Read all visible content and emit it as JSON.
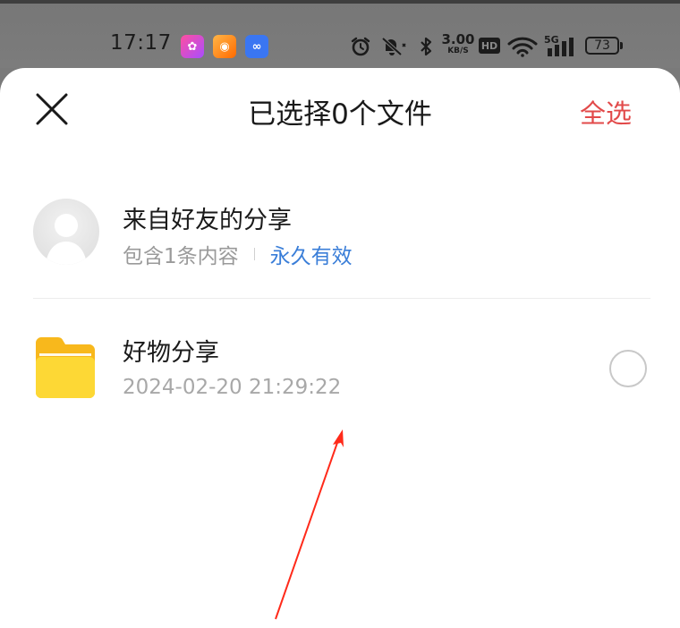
{
  "status_bar": {
    "time": "17:17",
    "app1_glyph": "✿",
    "app2_glyph": "◉",
    "app3_glyph": "∞",
    "net_speed_value": "3.00",
    "net_speed_unit": "KB/S",
    "hd_label": "HD",
    "network_label": "5G",
    "battery_level": "73",
    "icons": [
      "alarm-icon",
      "mute-icon",
      "bluetooth-icon",
      "wifi-icon",
      "signal-icon",
      "battery-icon"
    ]
  },
  "header": {
    "title": "已选择0个文件",
    "select_all_label": "全选",
    "close_icon": "close-icon"
  },
  "share": {
    "title": "来自好友的分享",
    "content_count": "包含1条内容",
    "validity": "永久有效",
    "avatar_icon": "person-icon"
  },
  "files": [
    {
      "name": "好物分享",
      "date": "2024-02-20 21:29:22",
      "icon": "folder-icon",
      "selected": false
    }
  ],
  "colors": {
    "accent_red": "#e24a4a",
    "link_blue": "#3a7ed8",
    "folder_yellow": "#fdd835",
    "annotation_arrow": "#ff2a1a"
  }
}
